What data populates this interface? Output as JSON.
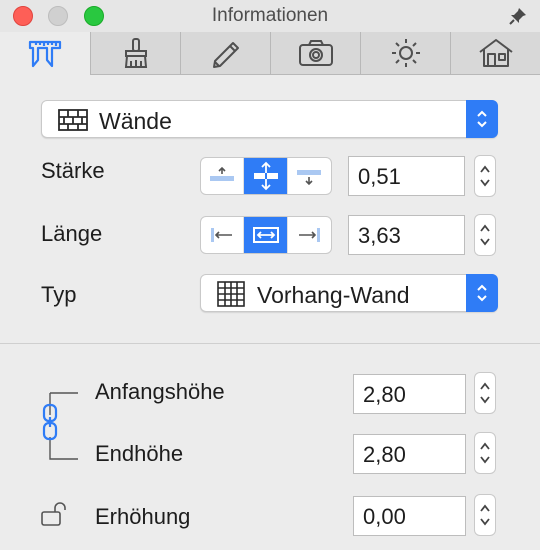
{
  "window": {
    "title": "Informationen"
  },
  "tabs": [
    {
      "icon": "caliper-icon",
      "active": true
    },
    {
      "icon": "brush-icon",
      "active": false
    },
    {
      "icon": "pencil-icon",
      "active": false
    },
    {
      "icon": "camera-icon",
      "active": false
    },
    {
      "icon": "sun-icon",
      "active": false
    },
    {
      "icon": "house-icon",
      "active": false
    }
  ],
  "object_popup": {
    "label": "Wände",
    "icon": "brick-wall-icon"
  },
  "staerke": {
    "label": "Stärke",
    "value": "0,51",
    "selected_segment": "center"
  },
  "laenge": {
    "label": "Länge",
    "value": "3,63",
    "selected_segment": "center"
  },
  "typ": {
    "label": "Typ",
    "value": "Vorhang-Wand",
    "icon": "curtain-wall-icon"
  },
  "anfangshoehe": {
    "label": "Anfangshöhe",
    "value": "2,80"
  },
  "endhoehe": {
    "label": "Endhöhe",
    "value": "2,80"
  },
  "erhoehung": {
    "label": "Erhöhung",
    "value": "0,00"
  },
  "colors": {
    "accent": "#2f7cf6",
    "close": "#fe5f57",
    "zoom": "#29c840"
  }
}
